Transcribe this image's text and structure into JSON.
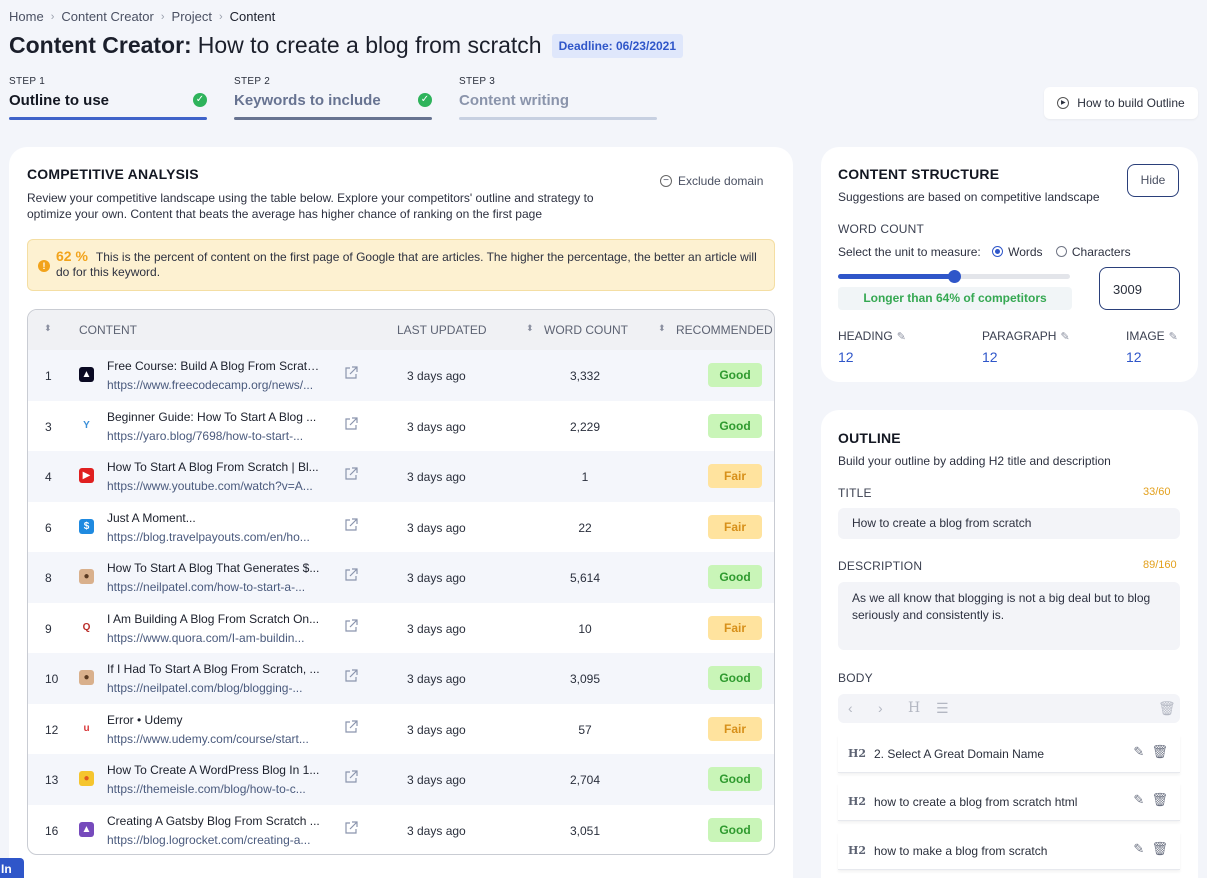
{
  "breadcrumb": [
    "Home",
    "Content Creator",
    "Project",
    "Content"
  ],
  "header": {
    "title_bold": "Content Creator:",
    "title_rest": "How to create a blog from scratch",
    "deadline": "Deadline: 06/23/2021"
  },
  "steps": [
    {
      "num": "STEP 1",
      "label": "Outline to use",
      "done": true,
      "color": "#3f63c9"
    },
    {
      "num": "STEP 2",
      "label": "Keywords to include",
      "done": true,
      "color": "#677391"
    },
    {
      "num": "STEP 3",
      "label": "Content writing",
      "done": false,
      "color": "#c7d0e1"
    }
  ],
  "how_button": "How to build Outline",
  "competitive": {
    "title": "COMPETITIVE ANALYSIS",
    "exclude": "Exclude domain",
    "description": "Review your competitive landscape using the table below. Explore your competitors' outline and strategy to optimize your own. Content that beats the average has higher chance of ranking on the first page",
    "alert_pct": "62 %",
    "alert_text": "This is the percent of content on the first page of Google that are articles. The higher the percentage, the better an article will do for this keyword.",
    "columns": {
      "content": "CONTENT",
      "updated": "LAST UPDATED",
      "wc": "WORD COUNT",
      "rec": "RECOMMENDED"
    },
    "rows": [
      {
        "idx": "1",
        "logo": "fcc-logo",
        "title": "Free Course: Build A Blog From Scratch With ...",
        "url": "https://www.freecodecamp.org/news/...",
        "updated": "3 days ago",
        "wc": "3,332",
        "rec": "Good"
      },
      {
        "idx": "3",
        "logo": "yaro-logo",
        "title": "Beginner Guide: How To Start A Blog ...",
        "url": "https://yaro.blog/7698/how-to-start-...",
        "updated": "3 days ago",
        "wc": "2,229",
        "rec": "Good"
      },
      {
        "idx": "4",
        "logo": "youtube-logo",
        "title": "How To Start A Blog From Scratch | Bl...",
        "url": "https://www.youtube.com/watch?v=A...",
        "updated": "3 days ago",
        "wc": "1",
        "rec": "Fair"
      },
      {
        "idx": "6",
        "logo": "travelpayouts-logo",
        "title": "Just A Moment...",
        "url": "https://blog.travelpayouts.com/en/ho...",
        "updated": "3 days ago",
        "wc": "22",
        "rec": "Fair"
      },
      {
        "idx": "8",
        "logo": "neilpatel-logo",
        "title": "How To Start A Blog That Generates $...",
        "url": "https://neilpatel.com/how-to-start-a-...",
        "updated": "3 days ago",
        "wc": "5,614",
        "rec": "Good"
      },
      {
        "idx": "9",
        "logo": "quora-logo",
        "title": "I Am Building A Blog From Scratch On...",
        "url": "https://www.quora.com/I-am-buildin...",
        "updated": "3 days ago",
        "wc": "10",
        "rec": "Fair"
      },
      {
        "idx": "10",
        "logo": "neilpatel-logo",
        "title": "If I Had To Start A Blog From Scratch, ...",
        "url": "https://neilpatel.com/blog/blogging-...",
        "updated": "3 days ago",
        "wc": "3,095",
        "rec": "Good"
      },
      {
        "idx": "12",
        "logo": "udemy-logo",
        "title": "Error • Udemy",
        "url": "https://www.udemy.com/course/start...",
        "updated": "3 days ago",
        "wc": "57",
        "rec": "Fair"
      },
      {
        "idx": "13",
        "logo": "themeisle-logo",
        "title": "How To Create A WordPress Blog In 1...",
        "url": "https://themeisle.com/blog/how-to-c...",
        "updated": "3 days ago",
        "wc": "2,704",
        "rec": "Good"
      },
      {
        "idx": "16",
        "logo": "logrocket-logo",
        "title": "Creating A Gatsby Blog From Scratch ...",
        "url": "https://blog.logrocket.com/creating-a...",
        "updated": "3 days ago",
        "wc": "3,051",
        "rec": "Good"
      }
    ]
  },
  "structure": {
    "title": "CONTENT STRUCTURE",
    "hide": "Hide",
    "sub": "Suggestions are based on competitive landscape",
    "wc_label": "WORD COUNT",
    "unit_label": "Select the unit to measure:",
    "unit_words": "Words",
    "unit_chars": "Characters",
    "slider_fraction": 0.5,
    "longer": "Longer than 64% of competitors",
    "wc_value": "3009",
    "heading_label": "HEADING",
    "heading": "12",
    "paragraph_label": "PARAGRAPH",
    "paragraph": "12",
    "image_label": "IMAGE",
    "image": "12"
  },
  "outline": {
    "title": "OUTLINE",
    "sub": "Build your outline by adding H2 title and description",
    "title_label": "TITLE",
    "title_count": "33/60",
    "title_value": "How to create a blog from scratch",
    "desc_label": "DESCRIPTION",
    "desc_count": "89/160",
    "desc_value": "As we all know that blogging is not a big deal but to blog seriously and consistently is.",
    "body_label": "BODY",
    "items": [
      {
        "tag": "H2",
        "text": "2. Select A Great Domain Name"
      },
      {
        "tag": "H2",
        "text": "how to create a blog from scratch html"
      },
      {
        "tag": "H2",
        "text": "how to make a blog from scratch"
      }
    ]
  },
  "corner_text": "In"
}
